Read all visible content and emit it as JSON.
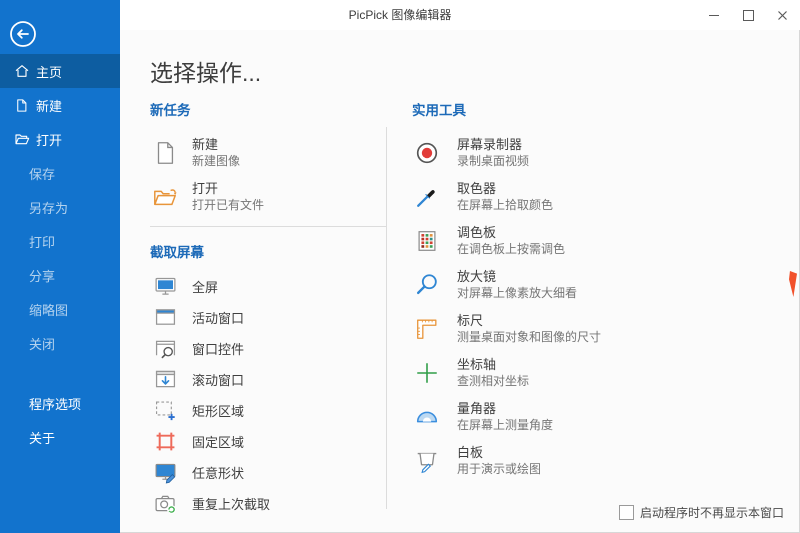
{
  "window": {
    "title": "PicPick 图像编辑器",
    "controls": [
      "minimize",
      "maximize",
      "close"
    ]
  },
  "sidebar": {
    "back_icon": "back-arrow-circle",
    "items": [
      {
        "label": "主页",
        "icon": "home-icon",
        "selected": true
      },
      {
        "label": "新建",
        "icon": "new-file-icon"
      },
      {
        "label": "打开",
        "icon": "open-file-icon"
      },
      {
        "label": "保存",
        "disabled": true
      },
      {
        "label": "另存为",
        "disabled": true
      },
      {
        "label": "打印",
        "disabled": true
      },
      {
        "label": "分享",
        "disabled": true
      },
      {
        "label": "缩略图",
        "disabled": true
      },
      {
        "label": "关闭",
        "disabled": true
      },
      {
        "label": "程序选项"
      },
      {
        "label": "关于"
      }
    ]
  },
  "main": {
    "page_title": "选择操作...",
    "new_tasks": {
      "title": "新任务",
      "items": [
        {
          "title": "新建",
          "desc": "新建图像",
          "icon": "new-image-icon"
        },
        {
          "title": "打开",
          "desc": "打开已有文件",
          "icon": "open-folder-icon"
        }
      ]
    },
    "screen_capture": {
      "title": "截取屏幕",
      "items": [
        {
          "title": "全屏",
          "icon": "fullscreen-icon"
        },
        {
          "title": "活动窗口",
          "icon": "active-window-icon"
        },
        {
          "title": "窗口控件",
          "icon": "window-control-icon"
        },
        {
          "title": "滚动窗口",
          "icon": "scrolling-window-icon"
        },
        {
          "title": "矩形区域",
          "icon": "rectangle-region-icon"
        },
        {
          "title": "固定区域",
          "icon": "fixed-region-icon"
        },
        {
          "title": "任意形状",
          "icon": "freehand-shape-icon"
        },
        {
          "title": "重复上次截取",
          "icon": "repeat-capture-icon"
        }
      ]
    },
    "tools": {
      "title": "实用工具",
      "items": [
        {
          "title": "屏幕录制器",
          "desc": "录制桌面视频",
          "icon": "screen-recorder-icon"
        },
        {
          "title": "取色器",
          "desc": "在屏幕上拾取颜色",
          "icon": "color-picker-icon"
        },
        {
          "title": "调色板",
          "desc": "在调色板上按需调色",
          "icon": "color-palette-icon"
        },
        {
          "title": "放大镜",
          "desc": "对屏幕上像素放大细看",
          "icon": "magnifier-icon"
        },
        {
          "title": "标尺",
          "desc": "测量桌面对象和图像的尺寸",
          "icon": "ruler-icon"
        },
        {
          "title": "坐标轴",
          "desc": "查测相对坐标",
          "icon": "crosshair-icon"
        },
        {
          "title": "量角器",
          "desc": "在屏幕上测量角度",
          "icon": "protractor-icon"
        },
        {
          "title": "白板",
          "desc": "用于演示或绘图",
          "icon": "whiteboard-icon"
        }
      ]
    },
    "footer": {
      "checkbox_label": "启动程序时不再显示本窗口",
      "checked": false
    }
  },
  "colors": {
    "sidebar_blue": "#1273cd",
    "sidebar_selected_blue": "#0d5da1",
    "section_header_blue": "#1d6ab8",
    "accent_blue": "#2f86d3",
    "record_red": "#e23c39",
    "region_red": "#ee6a5a",
    "folder_orange": "#e8953a",
    "crosshair_green": "#2f9e48",
    "divider_gray": "#dcdcdc"
  }
}
